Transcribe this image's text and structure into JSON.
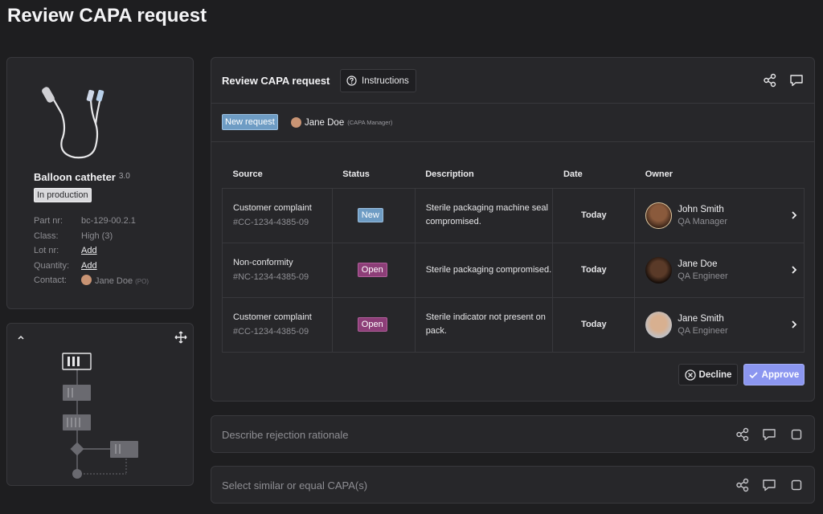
{
  "page": {
    "title": "Review CAPA request"
  },
  "product": {
    "name": "Balloon catheter",
    "version": "3.0",
    "status": "In production",
    "properties": [
      {
        "key": "Part nr:",
        "value": "bc-129-00.2.1",
        "link": false
      },
      {
        "key": "Class:",
        "value": "High (3)",
        "link": false
      },
      {
        "key": "Lot nr:",
        "value": "Add",
        "link": true
      },
      {
        "key": "Quantity:",
        "value": "Add",
        "link": true
      }
    ],
    "contact": {
      "key": "Contact:",
      "name": "Jane Doe",
      "role": "(PO)"
    }
  },
  "review": {
    "title": "Review CAPA request",
    "instructions_label": "Instructions",
    "request_status": "New request",
    "requester_name": "Jane Doe",
    "requester_role": "(CAPA Manager)",
    "columns": [
      "Source",
      "Status",
      "Description",
      "Date",
      "Owner"
    ],
    "rows": [
      {
        "source": "Customer complaint",
        "source_id": "#CC-1234-4385-09",
        "status": "New",
        "status_kind": "new",
        "description": "Sterile packaging machine seal compromised.",
        "date": "Today",
        "owner_name": "John Smith",
        "owner_role": "QA Manager",
        "avatar_color": "#6b4a32"
      },
      {
        "source": "Non-conformity",
        "source_id": "#NC-1234-4385-09",
        "status": "Open",
        "status_kind": "open",
        "description": "Sterile packaging compromised.",
        "date": "Today",
        "owner_name": "Jane Doe",
        "owner_role": "QA Engineer",
        "avatar_color": "#3d2a20"
      },
      {
        "source": "Customer complaint",
        "source_id": "#CC-1234-4385-09",
        "status": "Open",
        "status_kind": "open",
        "description": "Sterile indicator not present on pack.",
        "date": "Today",
        "owner_name": "Jane Smith",
        "owner_role": "QA Engineer",
        "avatar_color": "#c9a48a"
      }
    ],
    "decline_label": "Decline",
    "approve_label": "Approve"
  },
  "sections": [
    {
      "title": "Describe rejection rationale"
    },
    {
      "title": "Select similar or equal CAPA(s)"
    }
  ],
  "colors": {
    "accent": "#8b96f0",
    "badge_new": "#6e9cc4",
    "badge_open": "#8d3e78"
  }
}
